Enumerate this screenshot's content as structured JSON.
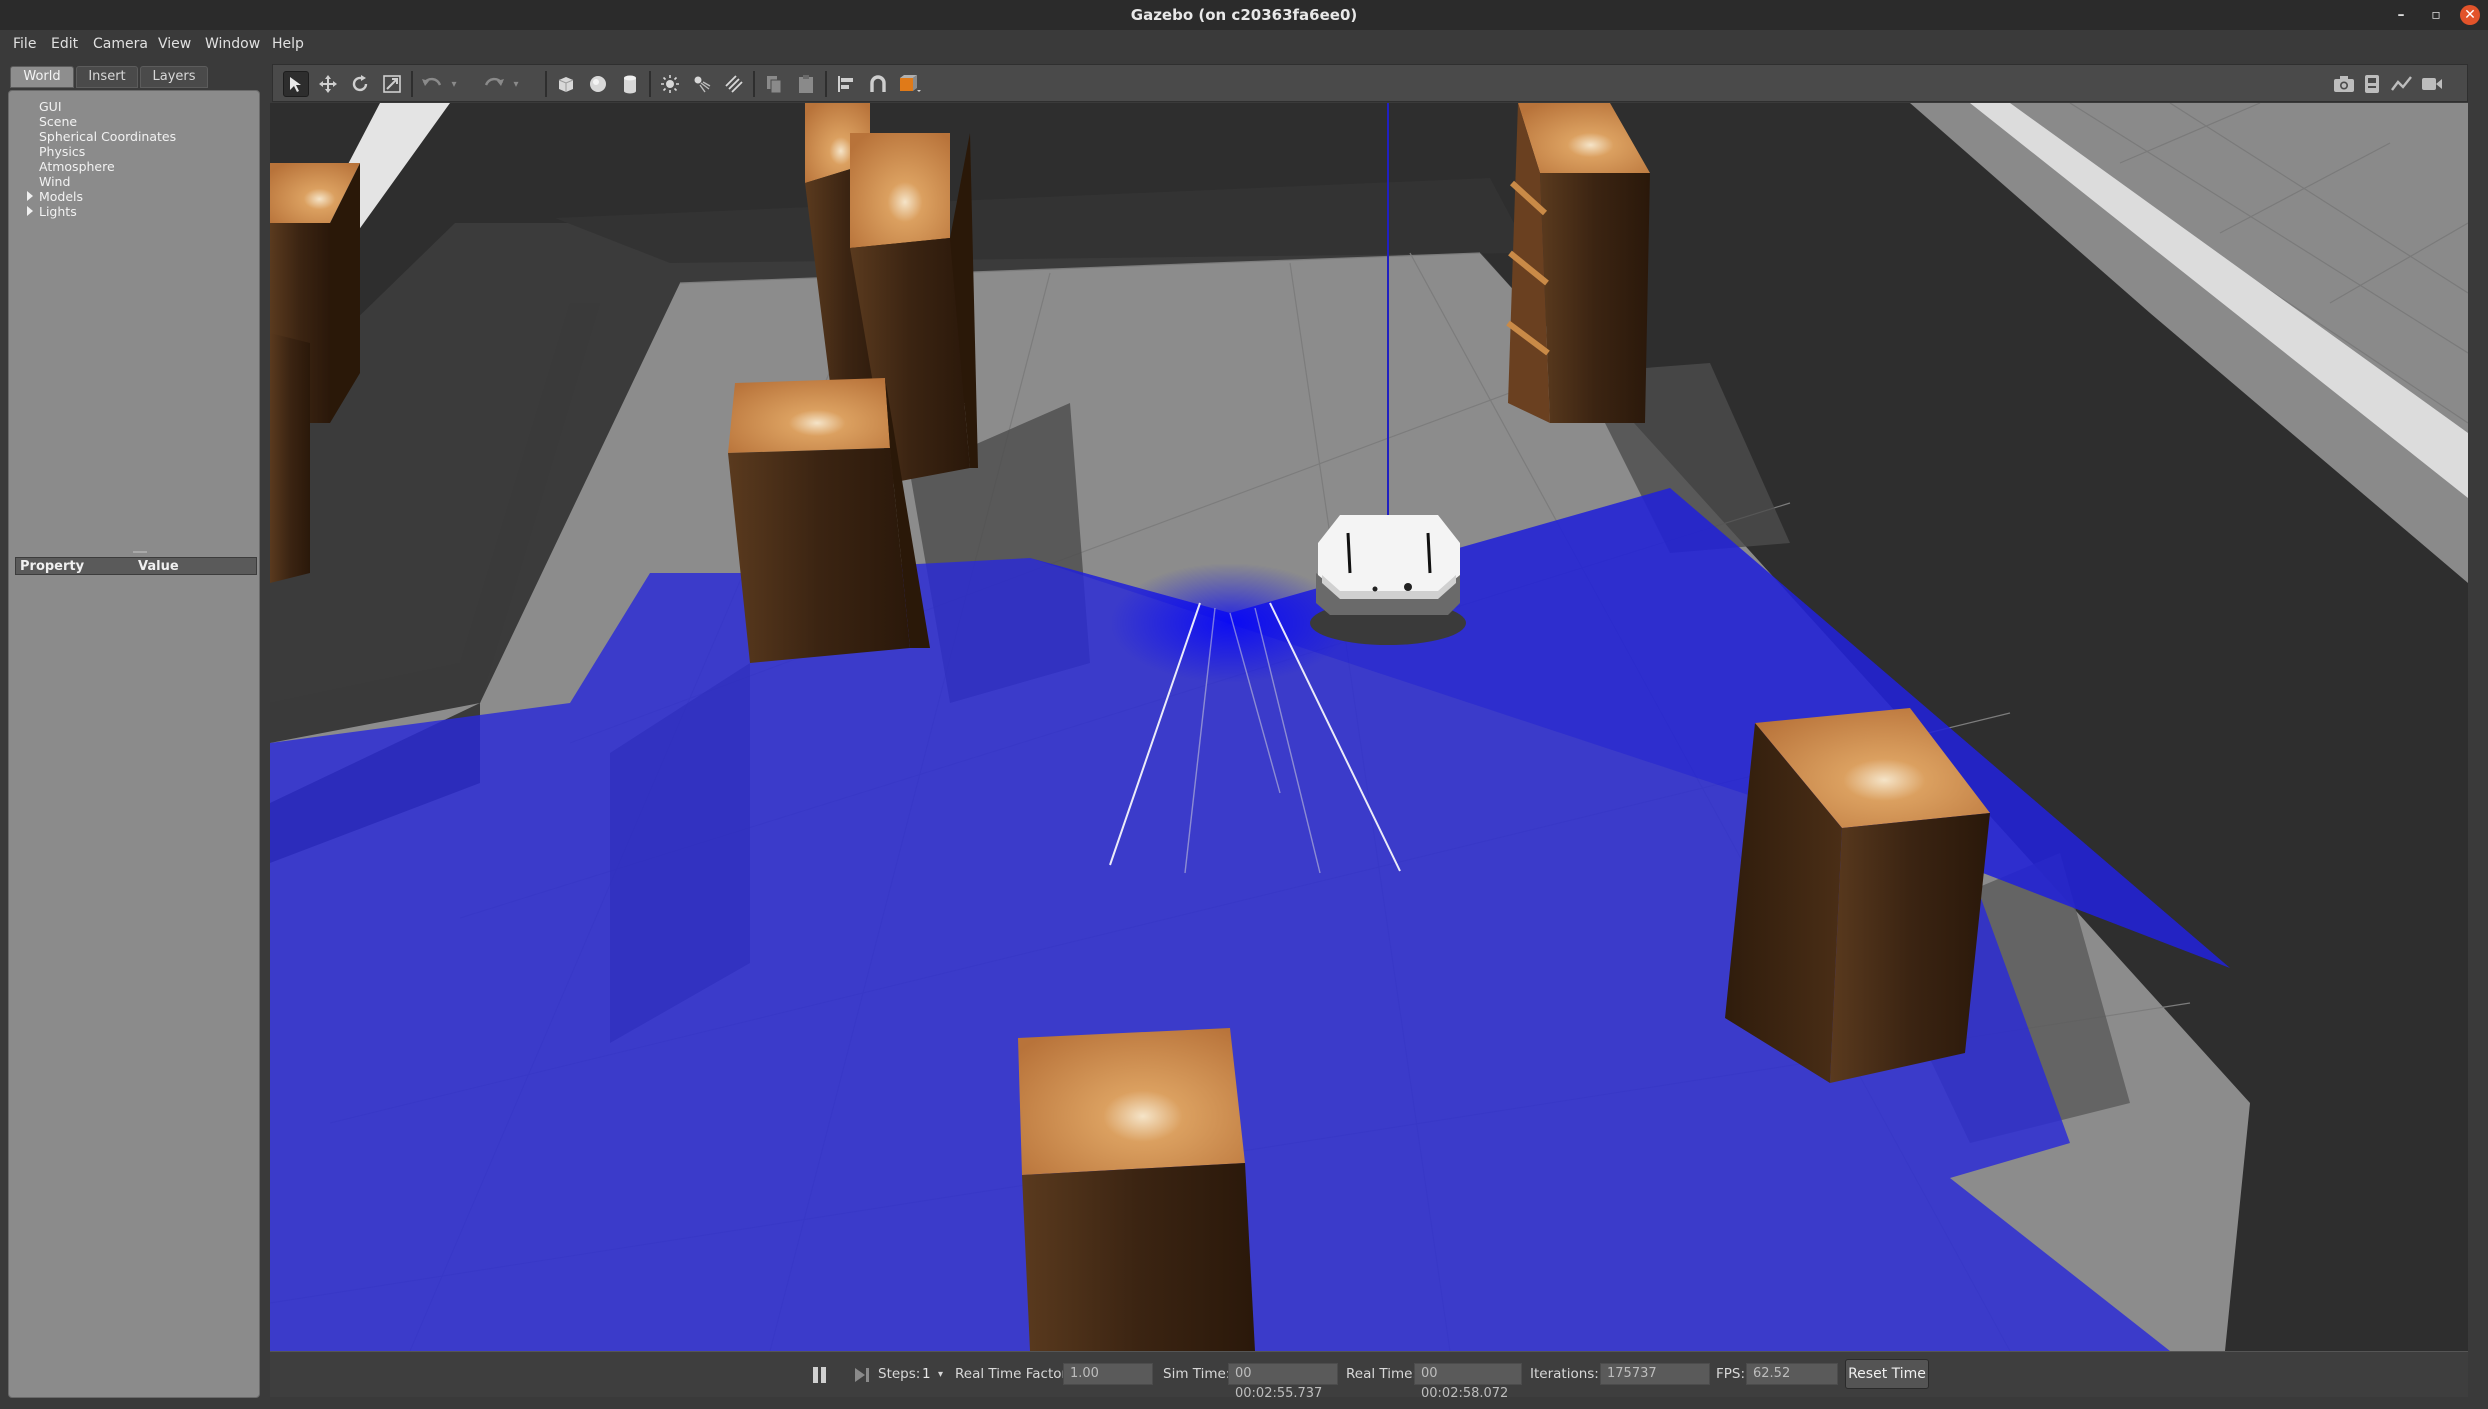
{
  "window": {
    "title": "Gazebo (on c20363fa6ee0)",
    "minimize_glyph": "–",
    "maximize_glyph": "▫",
    "close_glyph": "✕"
  },
  "menu": {
    "items": [
      "File",
      "Edit",
      "Camera",
      "View",
      "Window",
      "Help"
    ]
  },
  "left_panel": {
    "tabs": [
      "World",
      "Insert",
      "Layers"
    ],
    "active_tab": "World",
    "tree_items": [
      "GUI",
      "Scene",
      "Spherical Coordinates",
      "Physics",
      "Atmosphere",
      "Wind",
      "Models",
      "Lights"
    ],
    "expandable_items": [
      "Models",
      "Lights"
    ],
    "property_header": {
      "property": "Property",
      "value": "Value"
    }
  },
  "toolbar": {
    "tools": [
      {
        "name": "select-mode-icon",
        "active": true
      },
      {
        "name": "translate-mode-icon"
      },
      {
        "name": "rotate-mode-icon"
      },
      {
        "name": "scale-mode-icon"
      },
      {
        "name": "undo-icon"
      },
      {
        "name": "redo-icon"
      },
      {
        "name": "box-shape-icon"
      },
      {
        "name": "sphere-shape-icon"
      },
      {
        "name": "cylinder-shape-icon"
      },
      {
        "name": "point-light-icon"
      },
      {
        "name": "spot-light-icon"
      },
      {
        "name": "directional-light-icon"
      },
      {
        "name": "copy-icon"
      },
      {
        "name": "paste-icon"
      },
      {
        "name": "align-icon"
      },
      {
        "name": "snap-icon"
      },
      {
        "name": "change-view-icon"
      }
    ],
    "right_tools": [
      "screenshot-icon",
      "log-icon",
      "plot-icon",
      "record-icon"
    ]
  },
  "bottom_bar": {
    "steps_label": "Steps:",
    "steps_value": "1",
    "rtf_label": "Real Time Factor:",
    "rtf_value": "1.00",
    "sim_time_label": "Sim Time:",
    "sim_time_value": "00 00:02:55.737",
    "real_time_label": "Real Time:",
    "real_time_value": "00 00:02:58.072",
    "iterations_label": "Iterations:",
    "iterations_value": "175737",
    "fps_label": "FPS:",
    "fps_value": "62.52",
    "reset_label": "Reset Time"
  },
  "colors": {
    "laser": "#1f1fe0",
    "floor": "#8c8c8c",
    "ground": "#3a3a3a",
    "wood_top": "#c98a47",
    "wood_side": "#4a2e18"
  }
}
